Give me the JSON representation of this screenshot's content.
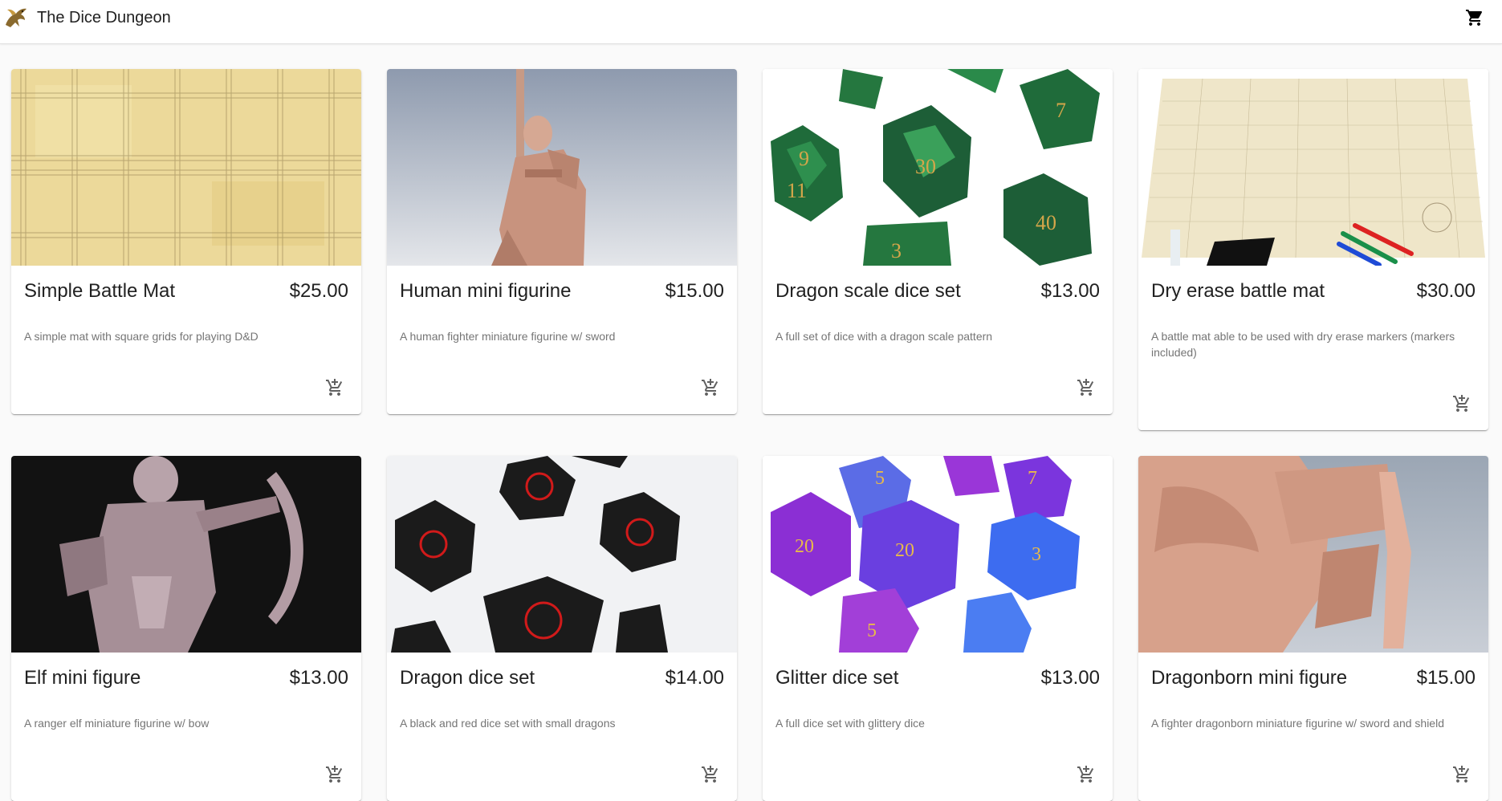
{
  "app": {
    "title": "The Dice Dungeon"
  },
  "icons": {
    "logo": "dragon-logo-icon",
    "cart": "shopping-cart-icon",
    "add_to_cart": "add-shopping-cart-icon"
  },
  "products": [
    {
      "name": "Simple Battle Mat",
      "price": "$25.00",
      "description": "A simple mat with square grids for playing D&D"
    },
    {
      "name": "Human mini figurine",
      "price": "$15.00",
      "description": "A human fighter miniature figurine w/ sword"
    },
    {
      "name": "Dragon scale dice set",
      "price": "$13.00",
      "description": "A full set of dice with a dragon scale pattern"
    },
    {
      "name": "Dry erase battle mat",
      "price": "$30.00",
      "description": "A battle mat able to be used with dry erase markers (markers included)"
    },
    {
      "name": "Elf mini figure",
      "price": "$13.00",
      "description": "A ranger elf miniature figurine w/ bow"
    },
    {
      "name": "Dragon dice set",
      "price": "$14.00",
      "description": "A black and red dice set with small dragons"
    },
    {
      "name": "Glitter dice set",
      "price": "$13.00",
      "description": "A full dice set with glittery dice"
    },
    {
      "name": "Dragonborn mini figure",
      "price": "$15.00",
      "description": "A fighter dragonborn miniature figurine w/ sword and shield"
    }
  ]
}
